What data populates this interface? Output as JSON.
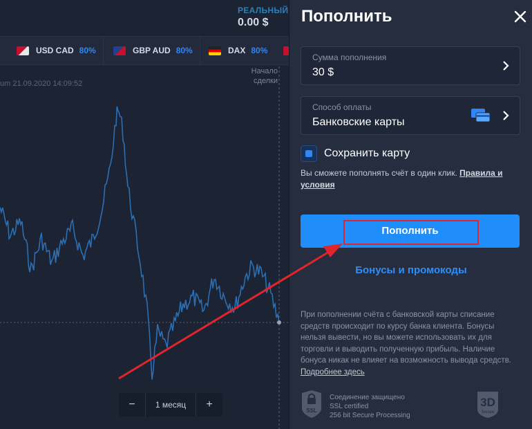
{
  "trade": {
    "balance_label": "РЕАЛЬНЫЙ СЧЁТ",
    "balance_value": "0.00 $",
    "assets": [
      {
        "name": "USD CAD",
        "pct": "80%"
      },
      {
        "name": "GBP AUD",
        "pct": "80%"
      },
      {
        "name": "DAX",
        "pct": "80%"
      }
    ],
    "deal_start": "Начало сделки",
    "chart_date": "um 21.09.2020 14:09:52",
    "zoom": {
      "minus": "−",
      "value": "1 месяц",
      "plus": "+"
    }
  },
  "panel": {
    "title": "Пополнить",
    "amount": {
      "label": "Сумма пополнения",
      "value": "30 $"
    },
    "method": {
      "label": "Способ оплаты",
      "value": "Банковские карты"
    },
    "save_card": "Сохранить карту",
    "oneclick_text": "Вы сможете пополнять счёт в один клик. ",
    "oneclick_link": "Правила и условия",
    "deposit_button": "Пополнить",
    "bonus_link": "Бонусы и промокоды",
    "info_text": "При пополнении счёта с банковской карты списание средств происходит по курсу банка клиента. Бонусы нельзя вывести, но вы можете использовать их для торговли и выводить полученную прибыль. Наличие бонуса никак не влияет на возможность вывода средств. ",
    "info_link": "Подробнее здесь",
    "ssl_badge": "SSL",
    "ssl_lines": [
      "Соединение защищено",
      "SSL certified",
      "256 bit Secure Processing"
    ],
    "secure3d": {
      "big": "3D",
      "small": "Secure"
    }
  },
  "colors": {
    "accent": "#1f8efb",
    "chart_line": "#2b6fb5",
    "annotation": "#e0252c",
    "background": "#1b2232"
  }
}
